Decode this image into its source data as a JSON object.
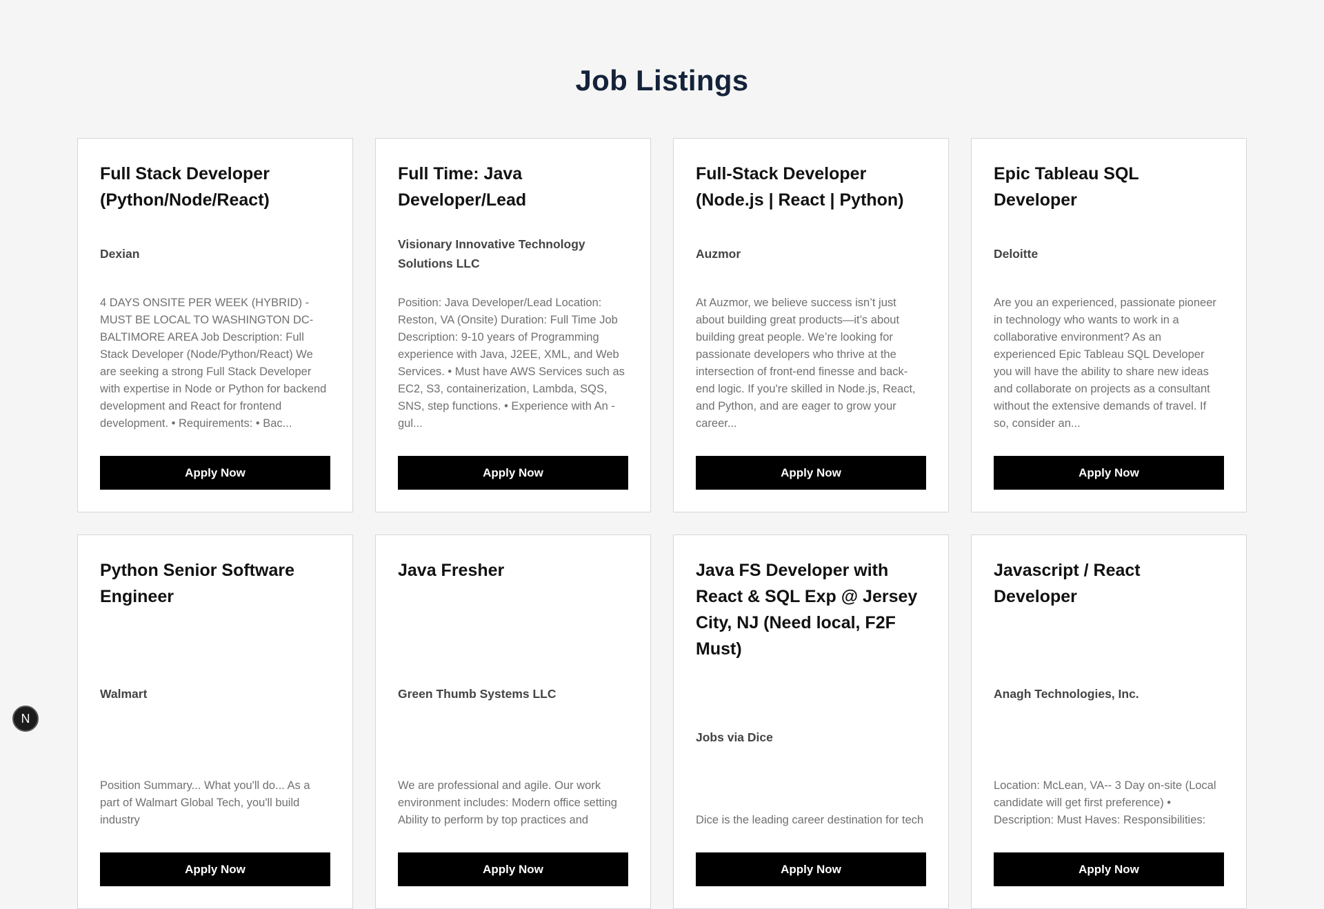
{
  "page": {
    "title": "Job Listings"
  },
  "apply_label": "Apply Now",
  "jobs": [
    {
      "title": "Full Stack Developer (Python/Node/React)",
      "company": "Dexian",
      "description": "4 DAYS ONSITE PER WEEK (HYBRID) - MUST BE LOCAL TO WASHINGTON DC-BALTIMORE AREA Job Description: Full Stack Developer (Node/Python/React) We are seeking a strong Full Stack Developer with expertise in Node or Python for backend development and React for frontend development. • Requirements: • Bac..."
    },
    {
      "title": "Full Time: Java Developer/Lead",
      "company": "Visionary Innovative Technology Solutions LLC",
      "description": "Position: Java Developer/Lead Location: Reston, VA (Onsite) Duration: Full Time Job Description: 9-10 years of Programming experience with Java, J2EE, XML, and Web Services. • Must have AWS Services such as EC2, S3, containerization, Lambda, SQS, SNS, step functions. • Experience with An - gul..."
    },
    {
      "title": "Full-Stack Developer (Node.js | React | Python)",
      "company": "Auzmor",
      "description": "At Auzmor, we believe success isn’t just about building great products—it’s about building great people. We’re looking for passionate developers who thrive at the intersection of front-end finesse and back-end logic. If you're skilled in Node.js, React, and Python, and are eager to grow your career..."
    },
    {
      "title": "Epic Tableau SQL Developer",
      "company": "Deloitte",
      "description": "Are you an experienced, passionate pioneer in technology who wants to work in a collaborative environment? As an experienced Epic Tableau SQL Developer you will have the ability to share new ideas and collaborate on projects as a consultant without the extensive demands of travel. If so, consider an..."
    },
    {
      "title": "Python Senior Software Engineer",
      "company": "Walmart",
      "description": "Position Summary... What you'll do... As a part of Walmart Global Tech, you'll build industry"
    },
    {
      "title": "Java Fresher",
      "company": "Green Thumb Systems LLC",
      "description": "We are professional and agile. Our work environment includes: Modern office setting Ability to perform by top practices and"
    },
    {
      "title": "Java FS Developer with React & SQL Exp @ Jersey City, NJ (Need local, F2F Must)",
      "company": "Jobs via Dice",
      "description": "Dice is the leading career destination for tech"
    },
    {
      "title": "Javascript / React Developer",
      "company": "Anagh Technologies, Inc.",
      "description": "Location: McLean, VA-- 3 Day on-site (Local candidate will get first preference) • Description: Must Haves: Responsibilities:"
    }
  ],
  "badge": {
    "letter": "N"
  }
}
